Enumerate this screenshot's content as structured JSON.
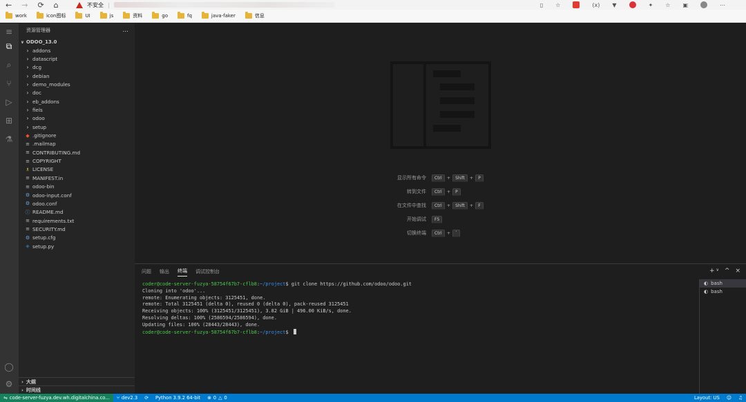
{
  "browser": {
    "security_label": "不安全",
    "bookmarks": [
      "work",
      "icon图标",
      "UI",
      "js",
      "资料",
      "go",
      "fq",
      "java-faker",
      "信息"
    ]
  },
  "sidebar": {
    "title": "资源管理器",
    "more": "...",
    "root": "ODOO_13.0",
    "folders": [
      "addons",
      "datascript",
      "dcg",
      "debian",
      "demo_modules",
      "doc",
      "eb_addons",
      "fiels",
      "odoo",
      "setup"
    ],
    "files": [
      {
        "name": ".gitignore",
        "icon": "git-icon"
      },
      {
        "name": ".mailmap",
        "icon": "file-lines-icon"
      },
      {
        "name": "CONTRIBUTING.md",
        "icon": "file-lines-icon"
      },
      {
        "name": "COPYRIGHT",
        "icon": "file-lines-icon"
      },
      {
        "name": "LICENSE",
        "icon": "license-icon"
      },
      {
        "name": "MANIFEST.in",
        "icon": "file-lines-icon"
      },
      {
        "name": "odoo-bin",
        "icon": "file-lines-icon"
      },
      {
        "name": "odoo-input.conf",
        "icon": "gear-icon"
      },
      {
        "name": "odoo.conf",
        "icon": "gear-icon"
      },
      {
        "name": "README.md",
        "icon": "info-icon"
      },
      {
        "name": "requirements.txt",
        "icon": "file-lines-icon"
      },
      {
        "name": "SECURITY.md",
        "icon": "file-lines-icon"
      },
      {
        "name": "setup.cfg",
        "icon": "gear-icon"
      },
      {
        "name": "setup.py",
        "icon": "python-icon"
      }
    ],
    "outline": "大纲",
    "timeline": "时间线"
  },
  "editor": {
    "shortcuts": [
      {
        "label": "显示所有命令",
        "keys": [
          "Ctrl",
          "Shift",
          "P"
        ]
      },
      {
        "label": "转到文件",
        "keys": [
          "Ctrl",
          "P"
        ]
      },
      {
        "label": "在文件中查找",
        "keys": [
          "Ctrl",
          "Shift",
          "F"
        ]
      },
      {
        "label": "开始调试",
        "keys": [
          "F5"
        ]
      },
      {
        "label": "切换终端",
        "keys": [
          "Ctrl",
          "`"
        ]
      }
    ]
  },
  "panel": {
    "tabs": [
      "问题",
      "输出",
      "终端",
      "调试控制台"
    ],
    "active_tab": 2,
    "prompt_user": "coder@code-server-fuzya-58754f67b7-cflb8",
    "prompt_path": "~/project",
    "command": "git clone https://github.com/odoo/odoo.git",
    "output_lines": [
      "Cloning into 'odoo'...",
      "remote: Enumerating objects: 3125451, done.",
      "remote: Total 3125451 (delta 0), reused 0 (delta 0), pack-reused 3125451",
      "Receiving objects: 100% (3125451/3125451), 3.82 GiB | 496.00 KiB/s, done.",
      "Resolving deltas: 100% (2586594/2586594), done.",
      "Updating files: 100% (28443/28443), done."
    ],
    "terminals": [
      "bash",
      "bash"
    ]
  },
  "status": {
    "remote": "code-server-fuzya.dev.wh.digitalchina.co...",
    "branch": "dev2.3",
    "python": "Python 3.9.2 64-bit",
    "errors": "0",
    "warnings": "0",
    "layout": "Layout: US"
  },
  "colors": {
    "status_bar": "#007acc",
    "remote": "#16825d",
    "terminal_user": "#4ec94e",
    "terminal_path": "#3b8eea"
  }
}
